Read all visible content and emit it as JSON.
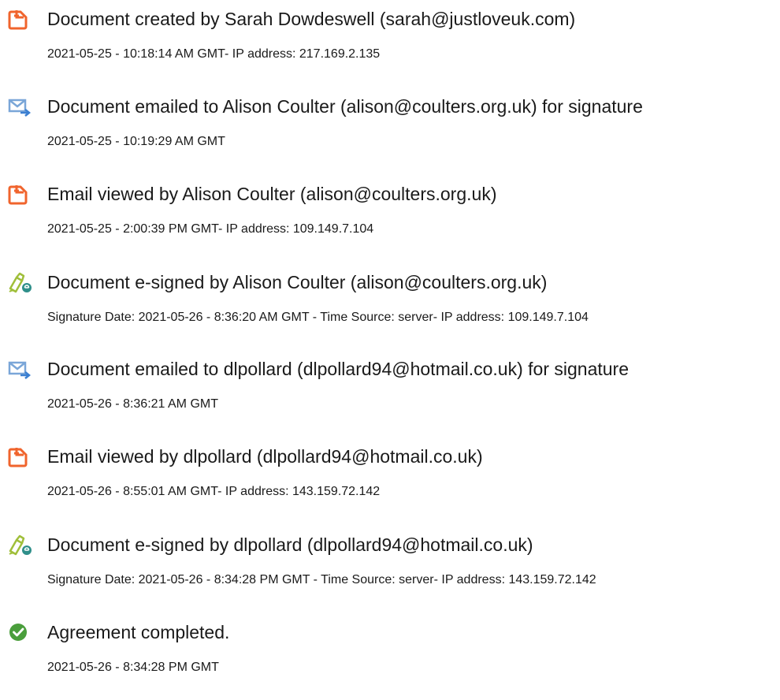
{
  "events": [
    {
      "icon": "document-created-icon",
      "title": "Document created by Sarah Dowdeswell (sarah@justloveuk.com)",
      "detail": "2021-05-25 - 10:18:14 AM GMT- IP address: 217.169.2.135"
    },
    {
      "icon": "document-emailed-icon",
      "title": "Document emailed to Alison Coulter (alison@coulters.org.uk) for signature",
      "detail": "2021-05-25 - 10:19:29 AM GMT"
    },
    {
      "icon": "email-viewed-icon",
      "title": "Email viewed by Alison Coulter (alison@coulters.org.uk)",
      "detail": "2021-05-25 - 2:00:39 PM GMT- IP address: 109.149.7.104"
    },
    {
      "icon": "e-signed-icon",
      "title": "Document e-signed by Alison Coulter (alison@coulters.org.uk)",
      "detail": "Signature Date: 2021-05-26 - 8:36:20 AM GMT - Time Source: server- IP address: 109.149.7.104"
    },
    {
      "icon": "document-emailed-icon",
      "title": "Document emailed to dlpollard (dlpollard94@hotmail.co.uk) for signature",
      "detail": "2021-05-26 - 8:36:21 AM GMT"
    },
    {
      "icon": "email-viewed-icon",
      "title": "Email viewed by dlpollard (dlpollard94@hotmail.co.uk)",
      "detail": "2021-05-26 - 8:55:01 AM GMT- IP address: 143.159.72.142"
    },
    {
      "icon": "e-signed-icon",
      "title": "Document e-signed by dlpollard (dlpollard94@hotmail.co.uk)",
      "detail": "Signature Date: 2021-05-26 - 8:34:28 PM GMT - Time Source: server- IP address: 143.159.72.142"
    },
    {
      "icon": "agreement-completed-icon",
      "title": "Agreement completed.",
      "detail": "2021-05-26 - 8:34:28 PM GMT"
    }
  ],
  "colors": {
    "document_icon": "#f0642d",
    "email_icon": "#7aa6d8",
    "email_arrow": "#3b7fd1",
    "pen_icon": "#a0bf3a",
    "signed_badge": "#2f8f8a",
    "completed_icon": "#4a9e3c"
  }
}
